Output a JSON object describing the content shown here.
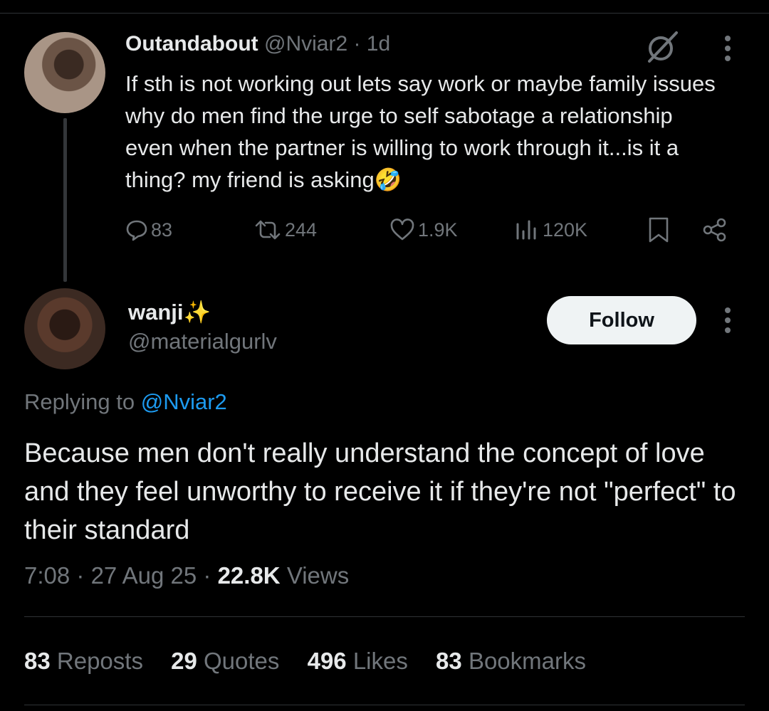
{
  "post1": {
    "name": "Outandabout",
    "handle": "@Nviar2",
    "time": "· 1d",
    "text": "If sth is not working out lets say work or maybe family issues why do men find the urge to self sabotage a relationship even when the partner is willing to work through it...is it a thing? my friend is asking🤣",
    "replies": "83",
    "reposts": "244",
    "likes": "1.9K",
    "views": "120K"
  },
  "post2": {
    "name": "wanji✨",
    "handle": "@materialgurlv",
    "follow_label": "Follow",
    "replying_prefix": "Replying to",
    "replying_handle": "@Nviar2",
    "text": "Because men don't really understand the concept of love and they feel unworthy to receive it if they're not \"perfect\" to their standard",
    "time": "7:08",
    "date": "27 Aug 25",
    "views_count": "22.8K",
    "views_label": "Views"
  },
  "stats": {
    "reposts_count": "83",
    "reposts_label": "Reposts",
    "quotes_count": "29",
    "quotes_label": "Quotes",
    "likes_count": "496",
    "likes_label": "Likes",
    "bookmarks_count": "83",
    "bookmarks_label": "Bookmarks"
  },
  "icons": [
    "grok-icon",
    "more-icon",
    "reply-icon",
    "repost-icon",
    "like-icon",
    "views-icon",
    "bookmark-icon",
    "share-icon"
  ],
  "colors": {
    "background": "#000000",
    "text": "#e7e9ea",
    "muted": "#71767b",
    "link": "#1d9bf0"
  }
}
